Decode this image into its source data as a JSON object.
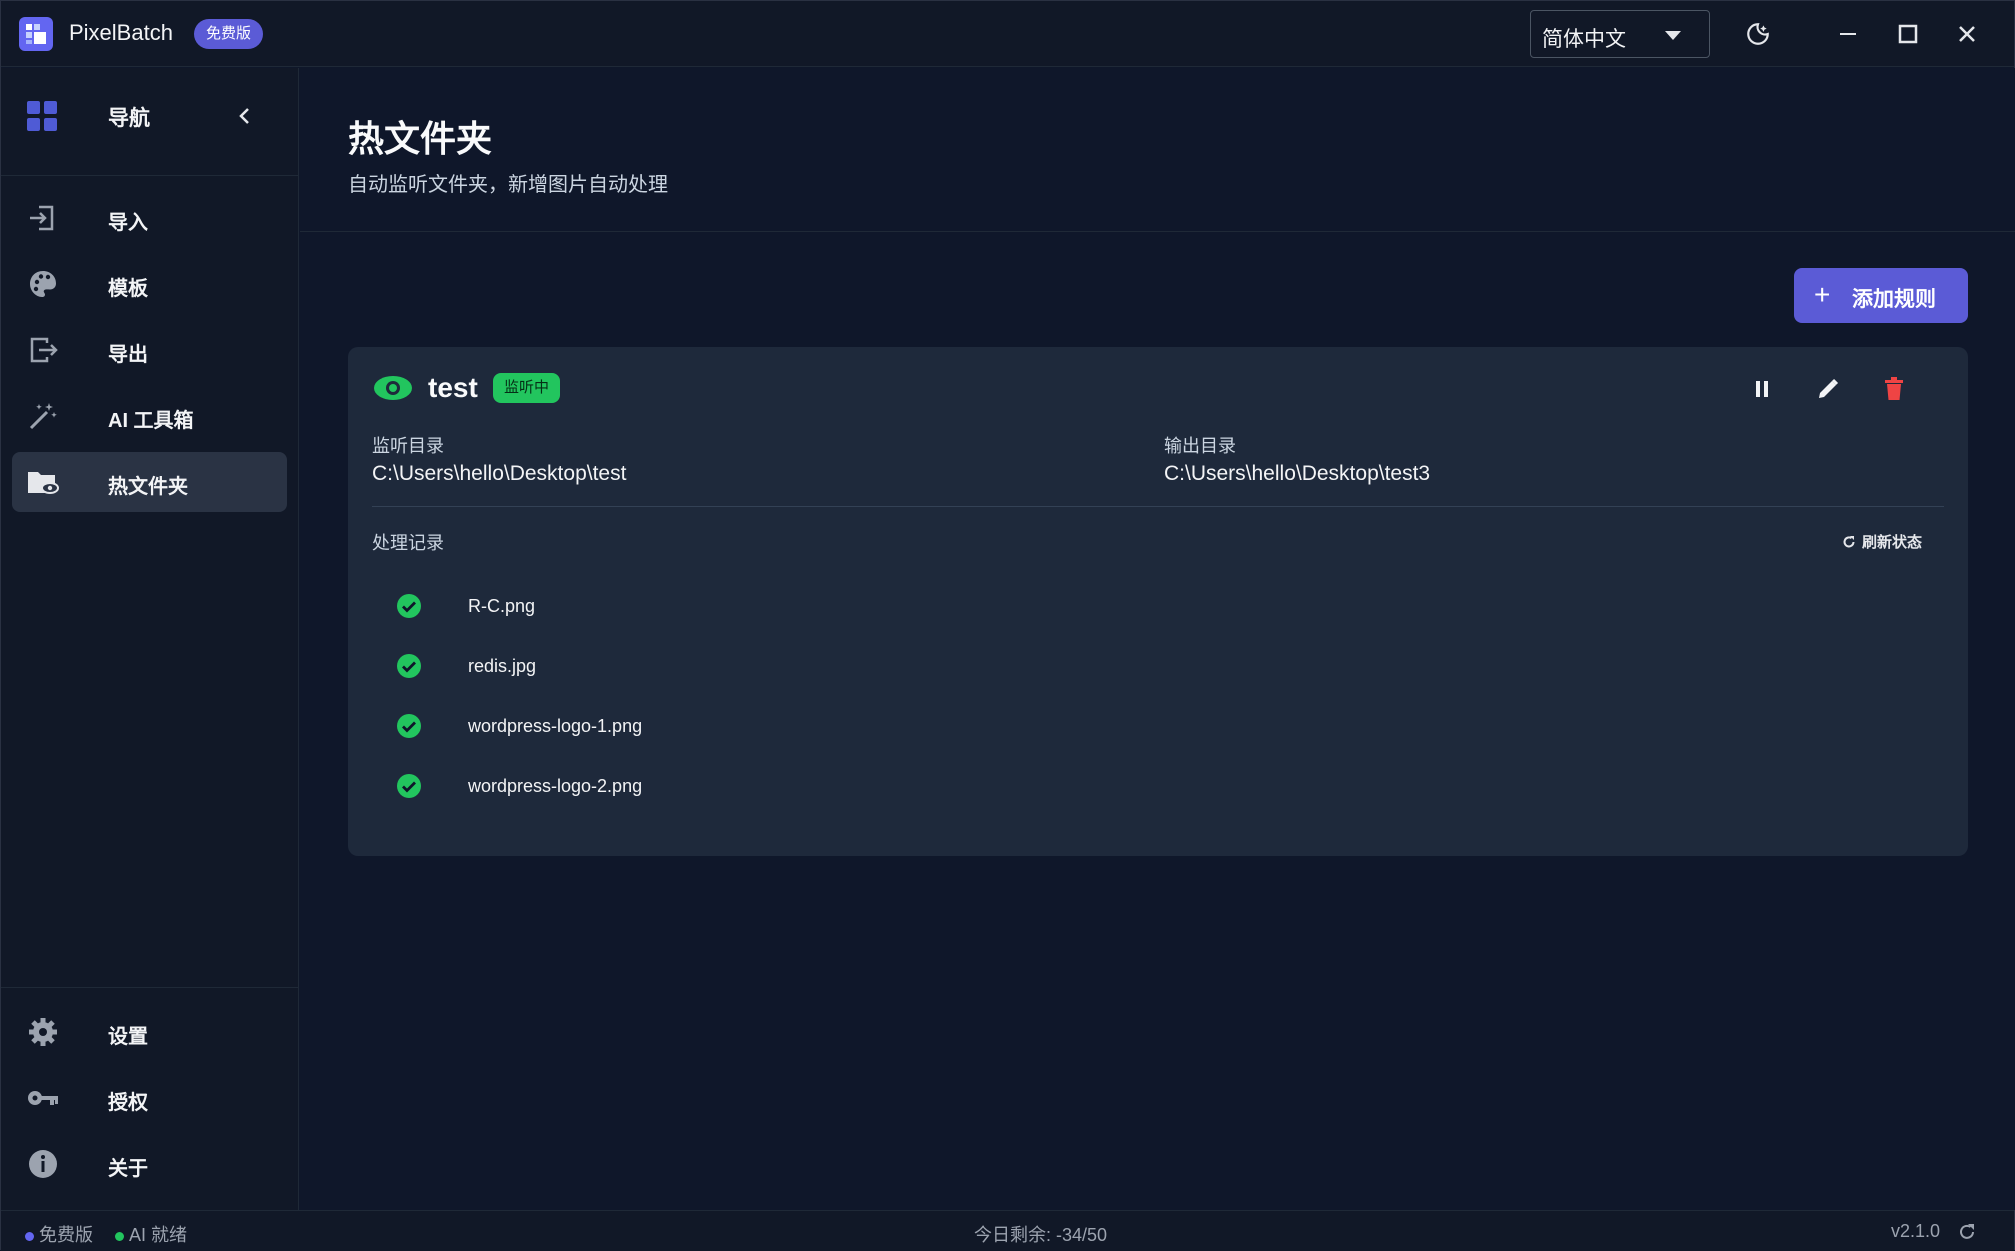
{
  "app": {
    "name": "PixelBatch",
    "edition_badge": "免费版",
    "language": "简体中文"
  },
  "sidebar": {
    "header": "导航",
    "items": [
      {
        "label": "导入",
        "icon": "import-icon"
      },
      {
        "label": "模板",
        "icon": "palette-icon"
      },
      {
        "label": "导出",
        "icon": "export-icon"
      },
      {
        "label": "AI 工具箱",
        "icon": "magic-wand-icon"
      },
      {
        "label": "热文件夹",
        "icon": "folder-eye-icon",
        "active": true
      }
    ],
    "bottom_items": [
      {
        "label": "设置",
        "icon": "gear-icon"
      },
      {
        "label": "授权",
        "icon": "key-icon"
      },
      {
        "label": "关于",
        "icon": "info-icon"
      }
    ]
  },
  "page": {
    "title": "热文件夹",
    "subtitle": "自动监听文件夹，新增图片自动处理",
    "add_button": "添加规则"
  },
  "rule": {
    "name": "test",
    "status": "监听中",
    "watch_dir_label": "监听目录",
    "watch_dir": "C:\\Users\\hello\\Desktop\\test",
    "output_dir_label": "输出目录",
    "output_dir": "C:\\Users\\hello\\Desktop\\test3",
    "log_title": "处理记录",
    "refresh_label": "刷新状态",
    "log": [
      {
        "file": "R-C.png",
        "status": "success"
      },
      {
        "file": "redis.jpg",
        "status": "success"
      },
      {
        "file": "wordpress-logo-1.png",
        "status": "success"
      },
      {
        "file": "wordpress-logo-2.png",
        "status": "success"
      }
    ]
  },
  "statusbar": {
    "edition": "免费版",
    "ai_status": "AI 就绪",
    "quota": "今日剩余: -34/50",
    "version": "v2.1.0"
  },
  "colors": {
    "accent": "#5b5bd6",
    "success": "#22c55e",
    "danger": "#ef4444"
  }
}
